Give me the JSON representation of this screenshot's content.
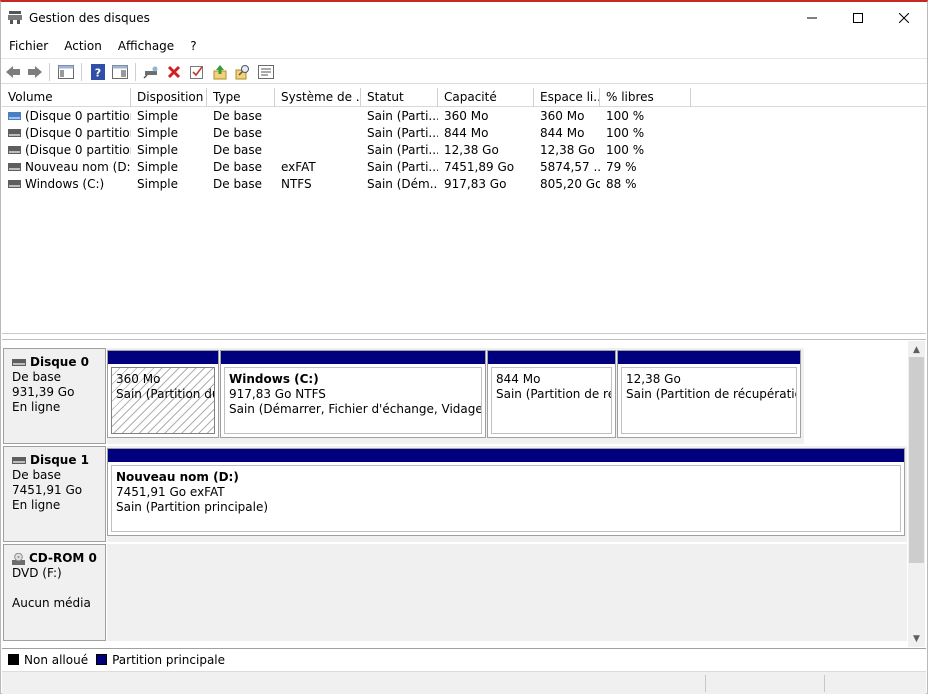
{
  "window": {
    "title": "Gestion des disques"
  },
  "menu": [
    "Fichier",
    "Action",
    "Affichage",
    "?"
  ],
  "toolbar": {
    "icons": [
      "back-arrow-icon",
      "forward-arrow-icon",
      "console-tree-icon",
      "help-icon",
      "properties-icon",
      "connect-icon",
      "delete-icon",
      "check-icon",
      "export-icon",
      "search-icon",
      "view-icon"
    ]
  },
  "list": {
    "columns": [
      "Volume",
      "Disposition",
      "Type",
      "Système de ...",
      "Statut",
      "Capacité",
      "Espace li...",
      "% libres"
    ],
    "rows": [
      {
        "volume": "(Disque 0 partition...",
        "disposition": "Simple",
        "type": "De base",
        "fs": "",
        "status": "Sain (Parti...",
        "capacity": "360 Mo",
        "free": "360 Mo",
        "pct": "100 %"
      },
      {
        "volume": "(Disque 0 partition...",
        "disposition": "Simple",
        "type": "De base",
        "fs": "",
        "status": "Sain (Parti...",
        "capacity": "844 Mo",
        "free": "844 Mo",
        "pct": "100 %"
      },
      {
        "volume": "(Disque 0 partition...",
        "disposition": "Simple",
        "type": "De base",
        "fs": "",
        "status": "Sain (Parti...",
        "capacity": "12,38 Go",
        "free": "12,38 Go",
        "pct": "100 %"
      },
      {
        "volume": "Nouveau nom (D:)",
        "disposition": "Simple",
        "type": "De base",
        "fs": "exFAT",
        "status": "Sain (Parti...",
        "capacity": "7451,89 Go",
        "free": "5874,57 ...",
        "pct": "79 %"
      },
      {
        "volume": "Windows (C:)",
        "disposition": "Simple",
        "type": "De base",
        "fs": "NTFS",
        "status": "Sain (Dém...",
        "capacity": "917,83 Go",
        "free": "805,20 Go",
        "pct": "88 %"
      }
    ]
  },
  "disks": [
    {
      "name": "Disque 0",
      "type": "De base",
      "size": "931,39 Go",
      "state": "En ligne",
      "partitions": [
        {
          "title": "",
          "size": "360 Mo",
          "status": "Sain (Partition du s"
        },
        {
          "title": "Windows  (C:)",
          "size": "917,83 Go NTFS",
          "status": "Sain (Démarrer, Fichier d'échange, Vidage sur in"
        },
        {
          "title": "",
          "size": "844 Mo",
          "status": "Sain (Partition de récu"
        },
        {
          "title": "",
          "size": "12,38 Go",
          "status": "Sain (Partition de récupération)"
        }
      ]
    },
    {
      "name": "Disque 1",
      "type": "De base",
      "size": "7451,91 Go",
      "state": "En ligne",
      "partitions": [
        {
          "title": "Nouveau nom  (D:)",
          "size": "7451,91 Go exFAT",
          "status": "Sain (Partition principale)"
        }
      ]
    },
    {
      "name": "CD-ROM 0",
      "type": "DVD (F:)",
      "size": "",
      "state": "Aucun média",
      "partitions": []
    }
  ],
  "legend": {
    "unallocated": "Non alloué",
    "primary": "Partition principale"
  },
  "colors": {
    "primary_partition": "#00007f",
    "unallocated": "#000000",
    "title_accent": "#c62828"
  }
}
